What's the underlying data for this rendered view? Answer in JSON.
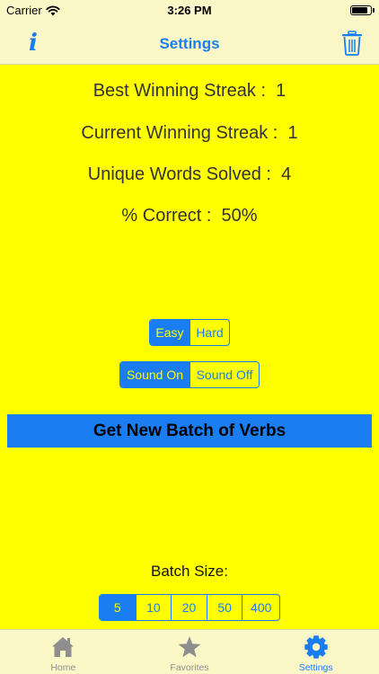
{
  "status_bar": {
    "carrier": "Carrier",
    "time": "3:26 PM",
    "battery_level": 0.9
  },
  "nav": {
    "title": "Settings",
    "info_icon": "info-icon",
    "trash_icon": "trash-icon"
  },
  "stats": {
    "best_streak": "Best Winning Streak :  1",
    "current_streak": "Current Winning Streak :  1",
    "unique_words": "Unique Words Solved :  4",
    "percent_correct": "% Correct :  50%"
  },
  "difficulty": {
    "options": [
      "Easy",
      "Hard"
    ],
    "selected": "Easy"
  },
  "sound": {
    "options": [
      "Sound On",
      "Sound Off"
    ],
    "selected": "Sound On"
  },
  "batch_button_label": "Get New Batch of Verbs",
  "batch_size": {
    "label": "Batch Size:",
    "options": [
      "5",
      "10",
      "20",
      "50",
      "400"
    ],
    "selected": "5"
  },
  "tabs": [
    {
      "label": "Home",
      "icon": "home-icon",
      "active": false
    },
    {
      "label": "Favorites",
      "icon": "star-icon",
      "active": false
    },
    {
      "label": "Settings",
      "icon": "gear-icon",
      "active": true
    }
  ],
  "colors": {
    "accent": "#1a7ef2",
    "background": "#ffff00",
    "bar": "#fbf7c7",
    "inactive": "#8e8e8e"
  }
}
